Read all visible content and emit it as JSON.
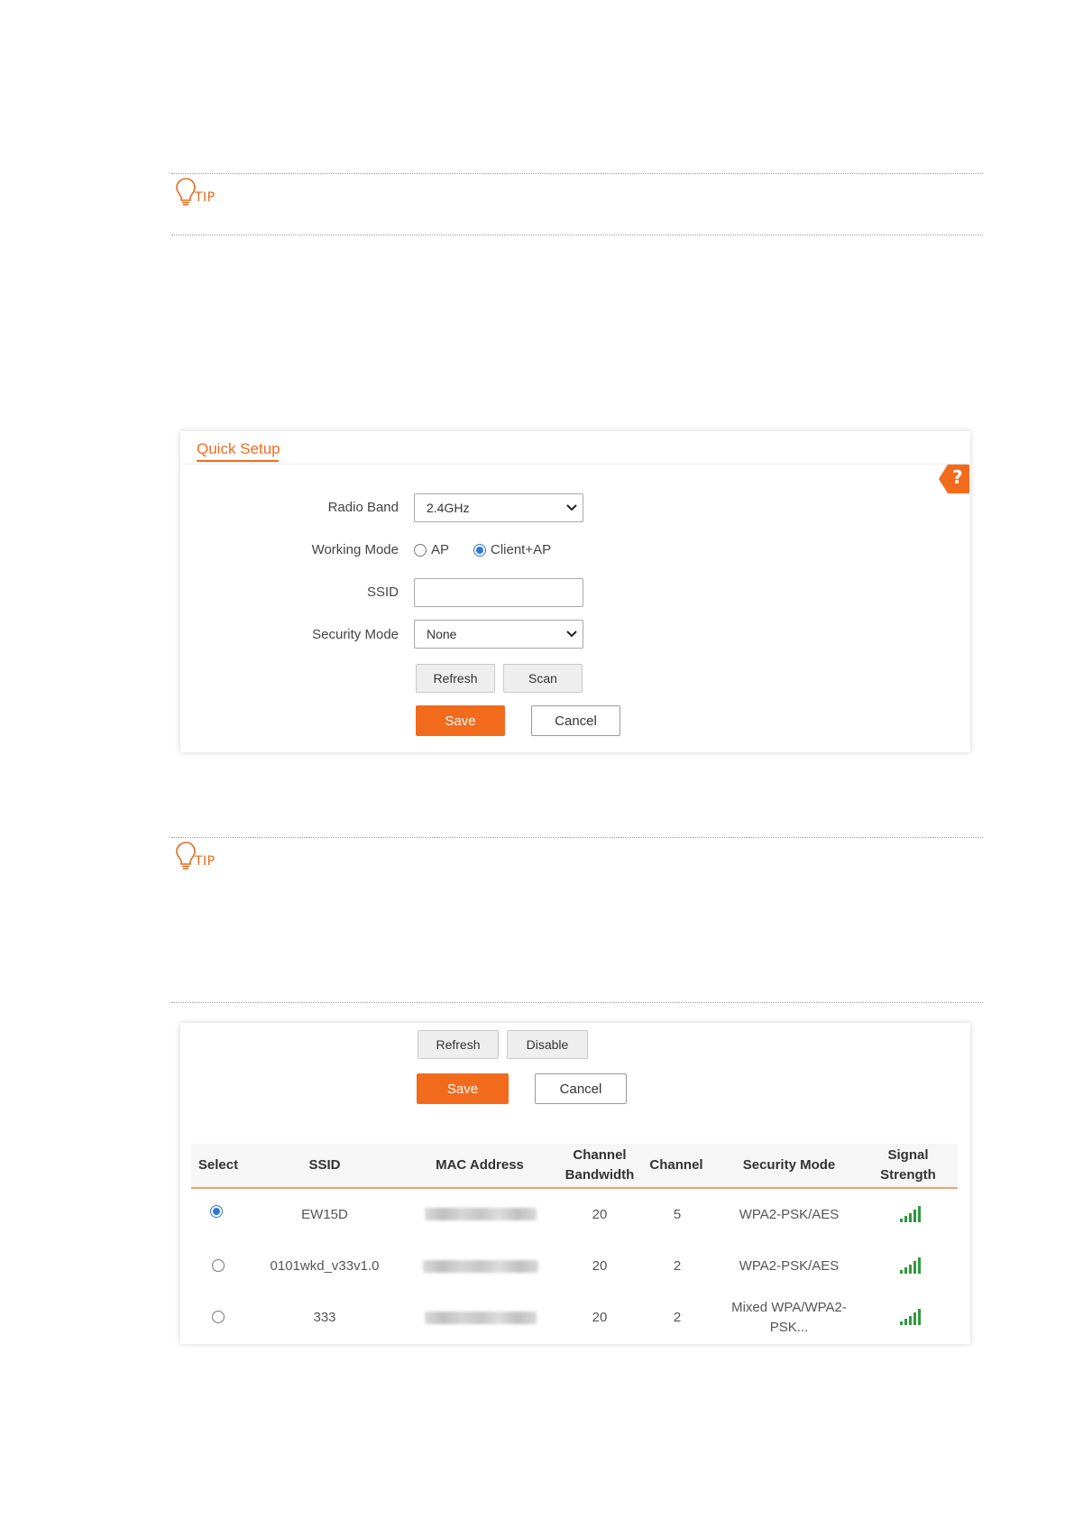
{
  "tips": [
    {
      "label": "TIP"
    },
    {
      "label": "TIP"
    }
  ],
  "quick_setup": {
    "title": "Quick Setup",
    "help_label": "?",
    "fields": {
      "radio_band": {
        "label": "Radio Band",
        "value": "2.4GHz"
      },
      "working_mode": {
        "label": "Working Mode",
        "options": [
          "AP",
          "Client+AP"
        ],
        "selected": "Client+AP"
      },
      "ssid": {
        "label": "SSID",
        "value": ""
      },
      "security_mode": {
        "label": "Security Mode",
        "value": "None"
      }
    },
    "buttons": {
      "refresh": "Refresh",
      "scan": "Scan",
      "save": "Save",
      "cancel": "Cancel"
    }
  },
  "scan_panel": {
    "buttons": {
      "refresh": "Refresh",
      "disable": "Disable",
      "save": "Save",
      "cancel": "Cancel"
    },
    "table": {
      "headers": {
        "select": "Select",
        "ssid": "SSID",
        "mac": "MAC Address",
        "bandwidth_line1": "Channel",
        "bandwidth_line2": "Bandwidth",
        "channel": "Channel",
        "security": "Security Mode",
        "signal_line1": "Signal",
        "signal_line2": "Strength"
      },
      "rows": [
        {
          "selected": true,
          "ssid": "EW15D",
          "bandwidth": "20",
          "channel": "5",
          "security_line1": "WPA2-PSK/AES",
          "security_line2": ""
        },
        {
          "selected": false,
          "ssid": "0101wkd_v33v1.0",
          "bandwidth": "20",
          "channel": "2",
          "security_line1": "WPA2-PSK/AES",
          "security_line2": ""
        },
        {
          "selected": false,
          "ssid": "333",
          "bandwidth": "20",
          "channel": "2",
          "security_line1": "Mixed WPA/WPA2-",
          "security_line2": "PSK..."
        }
      ]
    }
  },
  "colors": {
    "accent": "#f26b1d",
    "radio_selected": "#2d7ad6",
    "signal": "#2e9a3e"
  },
  "icons": [
    "lightbulb-icon",
    "help-icon",
    "chevron-down-icon",
    "signal-strength-icon"
  ]
}
